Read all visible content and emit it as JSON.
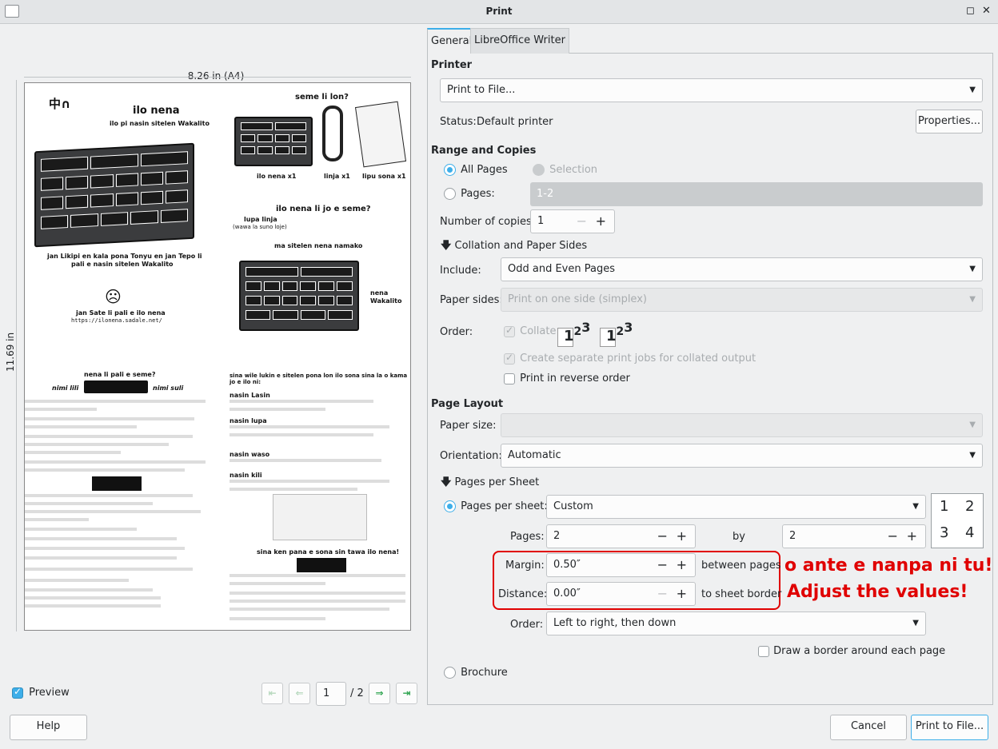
{
  "window": {
    "title": "Print",
    "maximize_glyph": "◻",
    "close_glyph": "✕"
  },
  "preview": {
    "width_label": "8.26 in (A4)",
    "height_label": "11.69 in",
    "show_label": "Preview",
    "page_current": "1",
    "page_total": "/ 2",
    "doc": {
      "left_title": "ilo nena",
      "left_subtitle": "ilo pi nasin sitelen Wakalito",
      "credits_1": "jan Likipi en kala pona Tonyu en jan Tepo li",
      "credits_2": "pali e nasin sitelen Wakalito",
      "maker": "jan Sate li pali e ilo nena",
      "url": "https://ilonena.sadale.net/",
      "q1": "seme li lon?",
      "item1": "ilo nena x1",
      "item2": "linja x1",
      "item3": "lipu sona x1",
      "q2": "ilo nena li jo e seme?",
      "cable": "lupa linja",
      "cable_sub": "(wawa la suno loje)",
      "ma_sitelen": "ma sitelen",
      "nena_namako": "nena namako",
      "nena_wak_1": "nena",
      "nena_wak_2": "Wakalito",
      "q3": "nena li pali e seme?",
      "nimi_lili": "nimi lili",
      "nimi_suli": "nimi suli",
      "q4": "sina wile lukin e sitelen pona lon ilo sona sina la o kama jo e ilo ni:",
      "nasin_lasin": "nasin Lasin",
      "nasin_lupa": "nasin lupa",
      "nasin_waso": "nasin waso",
      "nasin_kili": "nasin kili",
      "q5": "sina ken pana e sona sin tawa ilo nena!"
    }
  },
  "tabs": [
    {
      "label": "General"
    },
    {
      "label": "LibreOffice Writer"
    }
  ],
  "printer": {
    "section": "Printer",
    "selected": "Print to File...",
    "status_label": "Status:",
    "status_value": "Default printer",
    "properties_label": "Properties..."
  },
  "range": {
    "section": "Range and Copies",
    "all_pages": "All Pages",
    "selection": "Selection",
    "pages": "Pages:",
    "pages_value": "1-2",
    "copies_label": "Number of copies:",
    "copies_value": "1",
    "collation_toggle": "Collation and Paper Sides",
    "include_label": "Include:",
    "include_value": "Odd and Even Pages",
    "paper_sides_label": "Paper sides:",
    "paper_sides_value": "Print on one side (simplex)",
    "order_label": "Order:",
    "collate": "Collate",
    "separate_jobs": "Create separate print jobs for collated output",
    "reverse": "Print in reverse order"
  },
  "layout": {
    "section": "Page Layout",
    "paper_size_label": "Paper size:",
    "paper_size_value": "",
    "orientation_label": "Orientation:",
    "orientation_value": "Automatic",
    "pps_toggle": "Pages per Sheet",
    "pps_label": "Pages per sheet:",
    "pps_value": "Custom",
    "pages_label": "Pages:",
    "pages_x": "2",
    "by": "by",
    "pages_y": "2",
    "margin_label": "Margin:",
    "margin_value": "0.50″",
    "margin_suffix": "between pages",
    "distance_label": "Distance:",
    "distance_value": "0.00″",
    "distance_suffix": "to sheet border",
    "order_label": "Order:",
    "order_value": "Left to right, then down",
    "border": "Draw a border around each page",
    "brochure": "Brochure",
    "grid": [
      "1",
      "2",
      "3",
      "4"
    ]
  },
  "annotation": {
    "line1": "o ante e nanpa ni tu!",
    "line2": "Adjust the values!",
    "color": "#e00000"
  },
  "buttons": {
    "help": "Help",
    "cancel": "Cancel",
    "print": "Print to File..."
  },
  "icons": {
    "first": "⇤",
    "prev": "⇐",
    "next": "⇒",
    "last": "⇥",
    "minus": "−",
    "plus": "+",
    "down": "▼",
    "toggle": "🡇"
  }
}
